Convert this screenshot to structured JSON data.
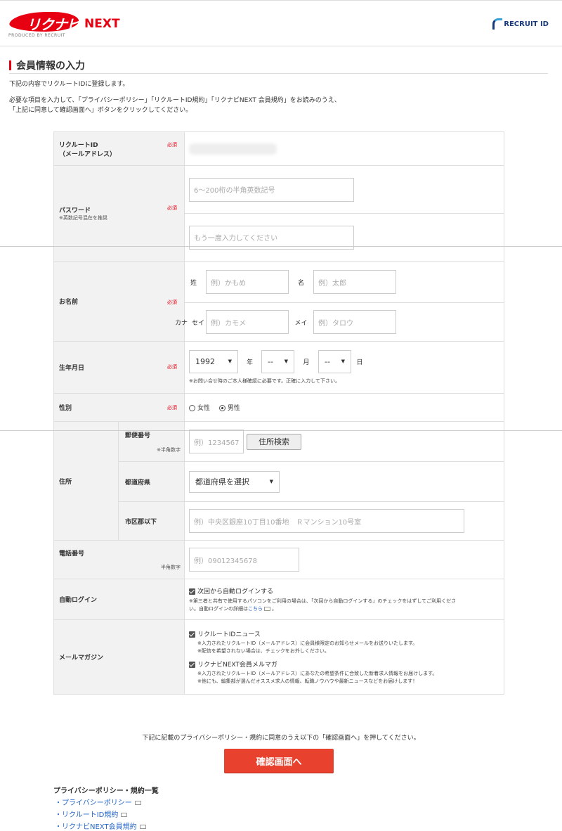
{
  "header": {
    "logo_text": "リクナビ",
    "logo_next": "NEXT",
    "logo_sub": "PRODUCED BY RECRUIT",
    "recruit_id": "RECRUIT ID"
  },
  "page": {
    "title": "会員情報の入力",
    "intro1": "下記の内容でリクルートIDに登録します。",
    "intro2": "必要な項目を入力して、「プライバシーポリシー」「リクルートID規約」「リクナビNEXT 会員規約」をお読みのうえ、",
    "intro3": "「上記に同意して確認画面へ」ボタンをクリックしてください。"
  },
  "form": {
    "required": "必須",
    "id_label1": "リクルートID",
    "id_label2": "（メールアドレス）",
    "pw_label": "パスワード",
    "pw_note": "※英数記号混在を推奨",
    "pw_placeholder": "6〜200桁の半角英数記号",
    "pw2_placeholder": "もう一度入力してください",
    "name_label": "お名前",
    "sei": "姓",
    "mei": "名",
    "sei_ph": "例）かもめ",
    "mei_ph": "例）太郎",
    "kana": "カナ",
    "sei_kana": "セイ",
    "mei_kana": "メイ",
    "sei_kana_ph": "例）カモメ",
    "mei_kana_ph": "例）タロウ",
    "birth_label": "生年月日",
    "year": "1992",
    "year_unit": "年",
    "month": "--",
    "month_unit": "月",
    "day": "--",
    "day_unit": "日",
    "birth_note": "※お問い合せ時のご本人様確認に必要です。正確に入力して下さい。",
    "gender_label": "性別",
    "female": "女性",
    "male": "男性",
    "addr_label": "住所",
    "zip_label": "郵便番号",
    "zip_note": "※半角数字",
    "zip_ph": "例）1234567",
    "addr_search": "住所検索",
    "pref_label": "都道府県",
    "pref_value": "都道府県を選択",
    "city_label": "市区郡以下",
    "city_ph": "例）中央区銀座10丁目10番地　Ｒマンション10号室",
    "tel_label": "電話番号",
    "tel_note": "半角数字",
    "tel_ph": "例）09012345678",
    "autologin_label": "自動ログイン",
    "autologin_text": "次回から自動ログインする",
    "autologin_note1": "※第三者と共有で使用するパソコンをご利用の場合は、「次回から自動ログインする」のチェックをはずしてご利用くださ",
    "autologin_note2a": "い。自動ログインの詳細は",
    "autologin_link": "こちら",
    "mail_label": "メールマガジン",
    "mag1": "リクルートIDニュース",
    "mag1_note1": "※入力されたリクルートID（メールアドレス）に会員様限定のお知らせメールをお送りいたします。",
    "mag1_note2": "※配信を希望されない場合は、チェックをお外しください。",
    "mag2": "リクナビNEXT会員メルマガ",
    "mag2_note1": "※入力されたリクルートID（メールアドレス）にあなたの希望条件に合致した新着求人情報をお届けします。",
    "mag2_note2": "※他にも、編集部が選んだオススメ求人の情報、転職ノウハウや最新ニュースなどをお届けします！"
  },
  "confirm": {
    "text": "下記に記載のプライバシーポリシー・規約に同意のうえ以下の「確認画面へ」を押してください。",
    "button": "確認画面へ"
  },
  "policy": {
    "title": "プライバシーポリシー・規約一覧",
    "links": [
      "・プライバシーポリシー",
      "・リクルートID規約",
      "・リクナビNEXT会員規約"
    ]
  }
}
